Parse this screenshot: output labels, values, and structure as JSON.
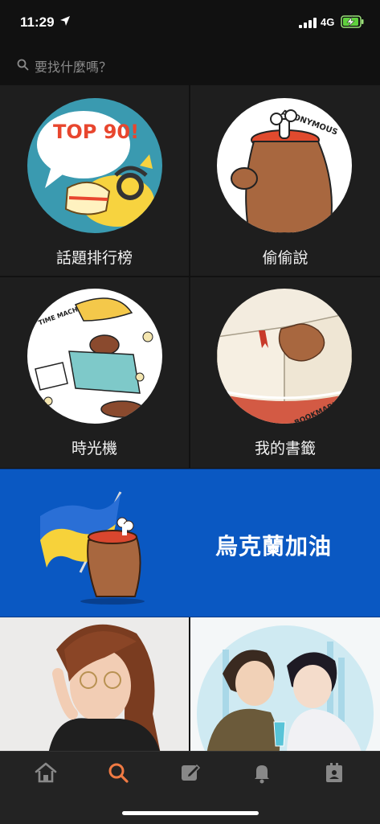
{
  "status_bar": {
    "time": "11:29",
    "network": "4G"
  },
  "search": {
    "placeholder": "要找什麼嗎？"
  },
  "tiles": [
    {
      "label": "話題排行榜",
      "art_text": "TOP 90!"
    },
    {
      "label": "偷偷說",
      "art_text": "ANONYMOUS"
    },
    {
      "label": "時光機",
      "art_text": "TIME MACHINE"
    },
    {
      "label": "我的書籤",
      "art_text": "BOOKMARK"
    }
  ],
  "banner": {
    "title": "烏克蘭加油"
  },
  "tabbar": {
    "items": [
      "home-icon",
      "search-icon",
      "compose-icon",
      "bell-icon",
      "profile-card-icon"
    ],
    "active": "search-icon"
  },
  "colors": {
    "accent": "#f07a43",
    "banner": "#0a58c2"
  }
}
